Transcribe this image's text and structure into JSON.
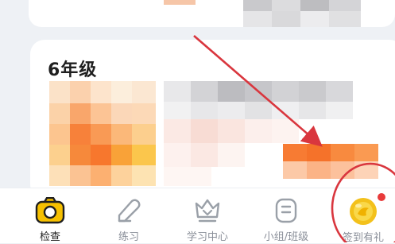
{
  "grade": {
    "title": "6年级"
  },
  "tabs": [
    {
      "label": "检查",
      "icon": "camera-icon",
      "active": true
    },
    {
      "label": "练习",
      "icon": "pencil-icon",
      "active": false
    },
    {
      "label": "学习中心",
      "icon": "crown-icon",
      "active": false
    },
    {
      "label": "小组/班级",
      "icon": "group-icon",
      "active": false
    },
    {
      "label": "签到有礼",
      "icon": "gold-coin-icon",
      "active": false,
      "badge": true
    }
  ],
  "colors": {
    "accent": "#f6c000",
    "annotation": "#d9363e",
    "badge": "#e83a3a",
    "mosaic_orange": "#f77b33"
  }
}
